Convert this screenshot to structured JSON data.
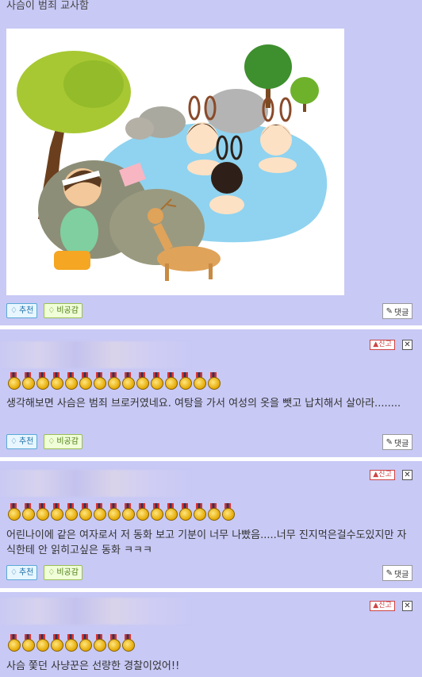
{
  "post": {
    "title": "사슴이 범죄 교사함",
    "actions": {
      "recommend": "추천",
      "nonempathy": "비공감",
      "reply": "댓글"
    }
  },
  "comments": [
    {
      "author_partial": "...이미MAMA",
      "medal_count": 15,
      "text": "생각해보면 사슴은 범죄 브로커였네요. 여탕을 가서 여성의 옷을 뺏고 납치해서 살아라........",
      "report": "신고",
      "close": "✕",
      "recommend": "추천",
      "nonempathy": "비공감",
      "reply": "댓글"
    },
    {
      "medal_count": 16,
      "text": "어린나이에 같은 여자로서 저 동화 보고 기분이 너무 나빴음.....너무 진지먹은걸수도있지만 자식한테 안 읽히고싶은 동화 ㅋㅋㅋ",
      "report": "신고",
      "close": "✕",
      "recommend": "추천",
      "nonempathy": "비공감",
      "reply": "댓글"
    },
    {
      "medal_count": 9,
      "text": "사슴 쫓던 사냥꾼은 선량한 경찰이었어!!",
      "report": "신고",
      "close": "✕"
    }
  ],
  "colors": {
    "background": "#c8c9f5",
    "separator": "#ffffff",
    "recommend": "#1a6fa8",
    "nonempathy": "#4d7a13",
    "report": "#cc4444"
  }
}
